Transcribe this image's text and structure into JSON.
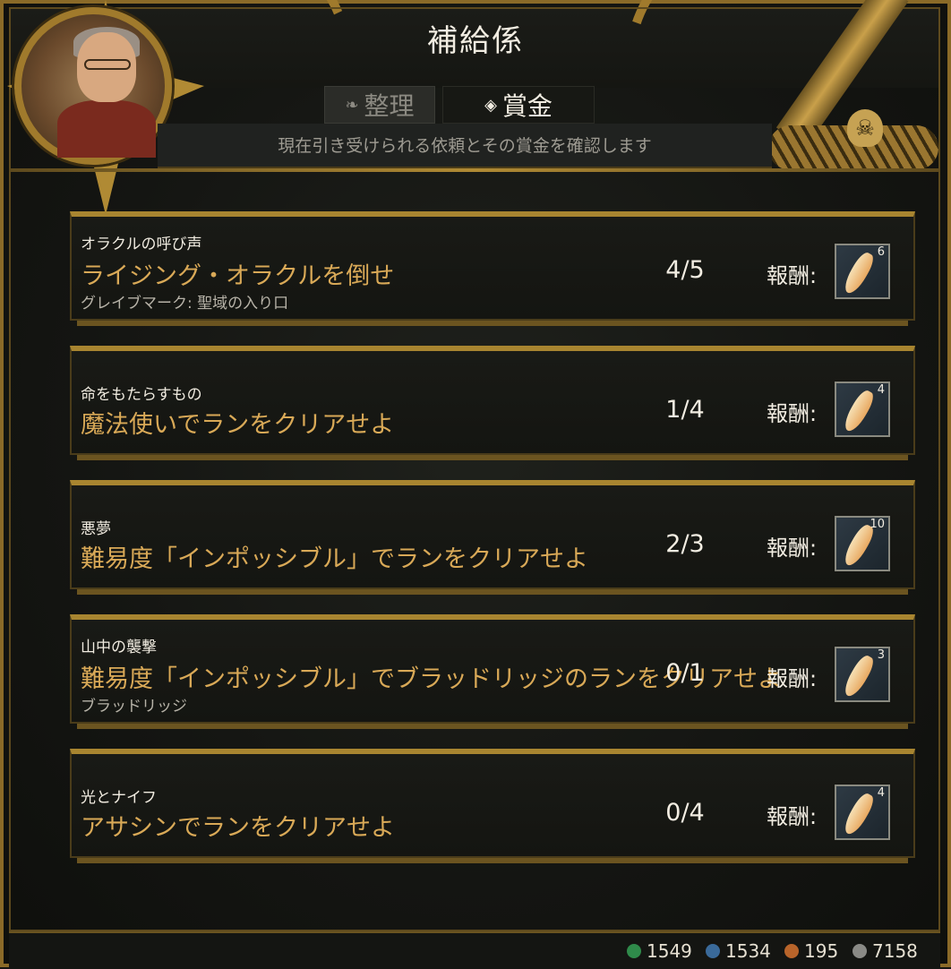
{
  "header": {
    "title": "補給係",
    "subtitle": "現在引き受けられる依頼とその賞金を確認します"
  },
  "tabs": [
    {
      "label": "整理",
      "icon": "scroll-icon",
      "active": false
    },
    {
      "label": "賞金",
      "icon": "diamond-icon",
      "active": true
    }
  ],
  "reward_label": "報酬:",
  "quests": [
    {
      "category": "オラクルの呼び声",
      "objective": "ライジング・オラクルを倒せ",
      "location": "グレイブマーク: 聖域の入り口",
      "progress": "4/5",
      "reward_count": "6",
      "reward_icon": "feather-quill-icon"
    },
    {
      "category": "命をもたらすもの",
      "objective": "魔法使いでランをクリアせよ",
      "location": "",
      "progress": "1/4",
      "reward_count": "4",
      "reward_icon": "feather-quill-icon"
    },
    {
      "category": "悪夢",
      "objective": "難易度「インポッシブル」でランをクリアせよ",
      "location": "",
      "progress": "2/3",
      "reward_count": "10",
      "reward_icon": "feather-quill-icon"
    },
    {
      "category": "山中の襲撃",
      "objective": "難易度「インポッシブル」でブラッドリッジのランをクリアせよ",
      "location": "ブラッドリッジ",
      "progress": "0/1",
      "reward_count": "3",
      "reward_icon": "feather-quill-icon"
    },
    {
      "category": "光とナイフ",
      "objective": "アサシンでランをクリアせよ",
      "location": "",
      "progress": "0/4",
      "reward_count": "4",
      "reward_icon": "feather-quill-icon"
    }
  ],
  "currencies": [
    {
      "value": "1549",
      "icon": "green-gem-icon",
      "color": "#2f8a4a"
    },
    {
      "value": "1534",
      "icon": "blue-gem-icon",
      "color": "#3a6a9a"
    },
    {
      "value": "195",
      "icon": "orange-gem-icon",
      "color": "#b8642a"
    },
    {
      "value": "7158",
      "icon": "grey-gem-icon",
      "color": "#8a8a86"
    }
  ]
}
